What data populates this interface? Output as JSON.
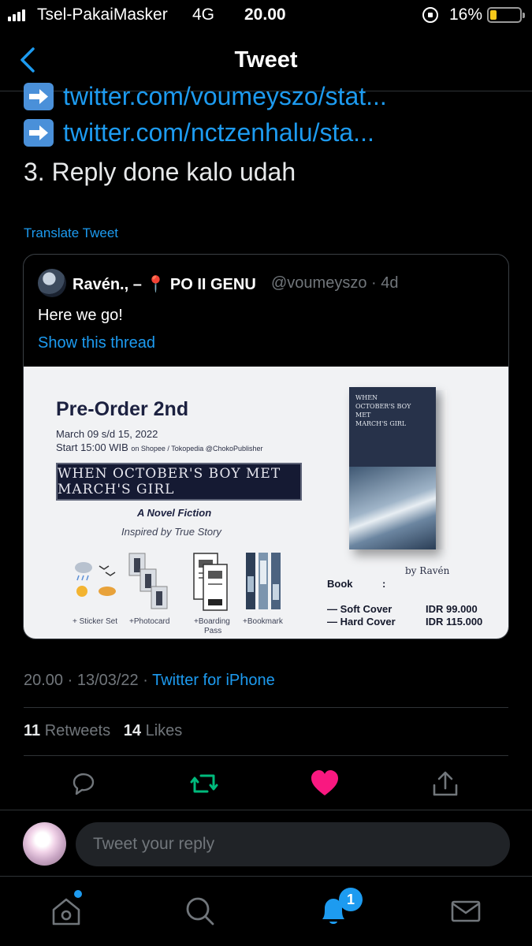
{
  "status": {
    "carrier": "Tsel-PakaiMasker",
    "network": "4G",
    "time": "20.00",
    "battery_percent": "16%",
    "battery_level": 0.16
  },
  "header": {
    "title": "Tweet",
    "back_icon": "chevron-left-icon"
  },
  "tweet": {
    "links": [
      "twitter.com/voumeyszo/stat...",
      "twitter.com/nctzenhalu/sta..."
    ],
    "link_icon": "right-arrow-emoji-icon",
    "body_line": "3. Reply done kalo udah",
    "translate_label": "Translate Tweet",
    "timestamp": "20.00 · 13/03/22 ·",
    "source": "Twitter for iPhone",
    "retweets_count": "11",
    "retweets_label": "Retweets",
    "likes_count": "14",
    "likes_label": "Likes"
  },
  "quote": {
    "name": "Ravén., –",
    "name_suffix": "PO II GENU",
    "pin_icon": "round-pushpin-icon",
    "handle_time": "@voumeyszo · 4d",
    "text": "Here we go!",
    "thread_link": "Show this thread",
    "image": {
      "title": "Pre-Order 2nd",
      "dates_line": "March 09 s/d 15, 2022",
      "start_line": "Start 15:00 WIB",
      "start_sub": "on Shopee / Tokopedia @ChokoPublisher",
      "banner": "WHEN OCTOBER'S BOY MET MARCH'S GIRL",
      "novel": "A Novel Fiction",
      "inspired": "Inspired by True Story",
      "merch": [
        "+ Sticker Set",
        "+Photocard",
        "+Boarding",
        "Pass",
        "+Bookmark"
      ],
      "book_cover_title": [
        "WHEN",
        "OCTOBER'S BOY",
        "MET",
        "MARCH'S GIRL"
      ],
      "author": "by Ravén",
      "book_label": "Book",
      "colon": ":",
      "prices": [
        {
          "label": "— Soft Cover",
          "price": "IDR 99.000"
        },
        {
          "label": "— Hard Cover",
          "price": "IDR 115.000"
        }
      ]
    }
  },
  "actions": {
    "reply_icon": "reply-bubble-icon",
    "retweet_icon": "retweet-icon",
    "like_icon": "heart-filled-icon",
    "share_icon": "share-icon",
    "retweet_color": "#00ba7c",
    "like_color": "#f91880"
  },
  "composer": {
    "placeholder": "Tweet your reply"
  },
  "tabs": {
    "home_icon": "home-icon",
    "search_icon": "search-icon",
    "notifications_icon": "bell-icon",
    "notifications_badge": "1",
    "messages_icon": "mail-icon"
  },
  "colors": {
    "accent": "#1d9bf0",
    "background": "#000000",
    "muted": "#71767b"
  }
}
